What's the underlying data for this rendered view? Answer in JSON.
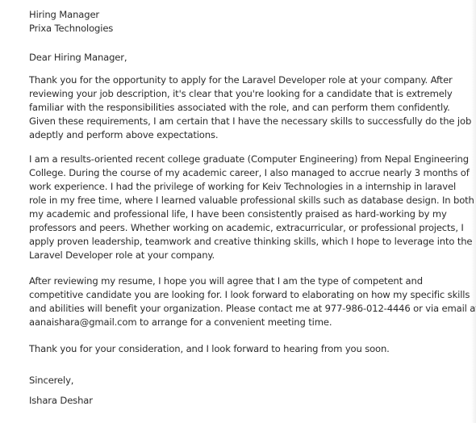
{
  "recipient": {
    "name": "Hiring Manager",
    "company": "Prixa Technologies"
  },
  "salutation": "Dear Hiring Manager,",
  "paragraph1": {
    "lines": [
      "Thank you for the opportunity to apply for the Laravel Developer role at your company. After",
      "reviewing your job description, it's clear that you're looking for a candidate that is extremely",
      "familiar with the responsibilities associated with the role, and can perform them confidently.",
      "Given these requirements, I am certain that I have the necessary skills to successfully do the job",
      "adeptly and perform above expectations."
    ]
  },
  "paragraph2": {
    "lines": [
      "I am a results-oriented recent college graduate (Computer Engineering) from Nepal Engineering",
      "College. During the course of my academic career, I also managed to accrue nearly 3 months of",
      "work experience. I had the privilege of working for Keiv Technologies in a internship in laravel",
      "role in my free time, where I learned valuable professional skills such as database design. In both",
      "my academic and professional life, I have been consistently praised as hard-working by my",
      "professors and peers. Whether working on academic, extracurricular, or professional projects, I",
      "apply proven leadership, teamwork and creative thinking skills, which I hope to leverage into the",
      "Laravel Developer role at your company."
    ]
  },
  "paragraph3": {
    "lines": [
      "After reviewing my resume, I hope you will agree that I am the type of competent and",
      "competitive candidate you are looking for. I look forward to elaborating on how my specific skills",
      "and abilities will benefit your organization. Please contact me at 977-986-012-4446 or via email at",
      "aanaishara@gmail.com to arrange for a convenient meeting time."
    ]
  },
  "closing_line": "Thank you for your consideration, and I look forward to hearing from you soon.",
  "signoff": "Sincerely,",
  "signature_name": "Ishara Deshar"
}
